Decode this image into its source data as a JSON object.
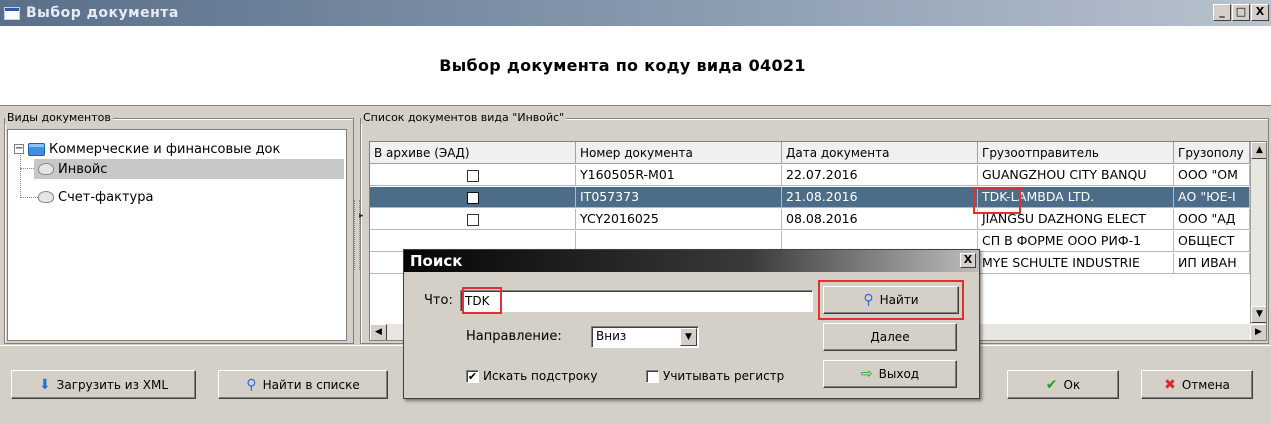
{
  "window": {
    "title": "Выбор документа",
    "controls": [
      "_",
      "□",
      "X"
    ]
  },
  "header": {
    "title": "Выбор документа по коду вида 04021"
  },
  "doc_types": {
    "legend": "Виды документов",
    "root": {
      "label": "Коммерческие и финансовые док",
      "expander": "−"
    },
    "items": [
      {
        "label": "Инвойс",
        "selected": true
      },
      {
        "label": "Счет-фактура",
        "selected": false
      }
    ]
  },
  "doc_list": {
    "legend": "Список документов вида \"Инвойс\"",
    "columns": [
      "В архиве (ЭАД)",
      "Номер документа",
      "Дата документа",
      "Грузоотправитель",
      "Грузополу"
    ],
    "rows": [
      {
        "number": "Y160505R-M01",
        "date": "22.07.2016",
        "shipper": "GUANGZHOU CITY BANQU",
        "consignee": "ООО \"ОМ",
        "selected": false
      },
      {
        "number": "IT057373",
        "date": "21.08.2016",
        "shipper": "TDK-LAMBDA LTD.",
        "consignee": "АО \"ЮЕ-I",
        "selected": true
      },
      {
        "number": "YCY2016025",
        "date": "08.08.2016",
        "shipper": "JIANGSU DAZHONG ELECT",
        "consignee": "ООО \"АД",
        "selected": false
      },
      {
        "number": "",
        "date": "",
        "shipper": "СП В ФОРМЕ ООО РИФ-1",
        "consignee": "ОБЩЕСТ",
        "selected": false
      },
      {
        "number": "",
        "date": "",
        "shipper": "MYE SCHULTE INDUSTRIE",
        "consignee": "ИП ИВАН",
        "selected": false
      }
    ],
    "row_marker": "▸"
  },
  "bottom_buttons": {
    "load_xml": "Загрузить из XML",
    "find_in_list": "Найти в списке",
    "ok": "Ок",
    "cancel": "Отмена"
  },
  "search_dialog": {
    "title": "Поиск",
    "close": "X",
    "what_label": "Что:",
    "what_value": "TDK",
    "direction_label": "Направление:",
    "direction_value": "Вниз",
    "substring_label": "Искать подстроку",
    "substring_checked": true,
    "case_label": "Учитывать регистр",
    "case_checked": false,
    "find_button": "Найти",
    "next_button": "Далее",
    "exit_button": "Выход"
  },
  "colors": {
    "selection": "#4c6d8a",
    "highlight": "#e23030",
    "dialog_title": "#050505"
  }
}
